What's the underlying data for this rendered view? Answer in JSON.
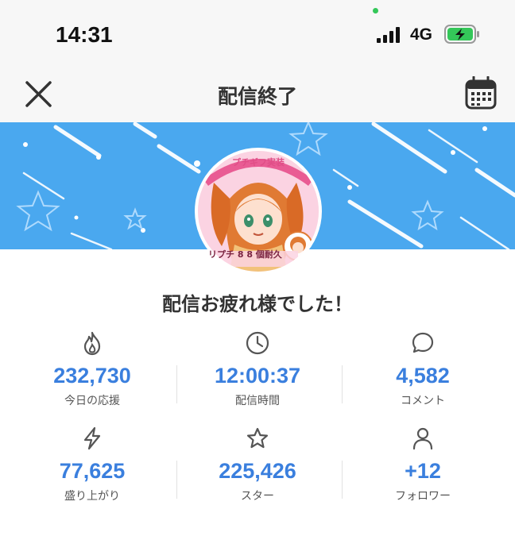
{
  "status_bar": {
    "time": "14:31",
    "network": "4G",
    "icons": [
      "signal-icon",
      "battery-charging-icon"
    ]
  },
  "nav": {
    "title": "配信終了",
    "left_icon": "close-icon",
    "right_icon": "calendar-icon"
  },
  "banner": {
    "background_color": "#4aa8ef",
    "avatar": {
      "caption_top": "プチギフ実装",
      "caption_bottom": "リプチ 8 8 個耐久"
    }
  },
  "message": "配信お疲れ様でした！",
  "stats": [
    {
      "icon": "flame-icon",
      "value": "232,730",
      "label": "今日の応援"
    },
    {
      "icon": "clock-icon",
      "value": "12:00:37",
      "label": "配信時間"
    },
    {
      "icon": "comment-icon",
      "value": "4,582",
      "label": "コメント"
    },
    {
      "icon": "lightning-icon",
      "value": "77,625",
      "label": "盛り上がり"
    },
    {
      "icon": "star-icon",
      "value": "225,426",
      "label": "スター"
    },
    {
      "icon": "person-icon",
      "value": "+12",
      "label": "フォロワー"
    }
  ],
  "colors": {
    "accent": "#3a7fde",
    "banner": "#4aa8ef",
    "battery": "#34c759"
  }
}
